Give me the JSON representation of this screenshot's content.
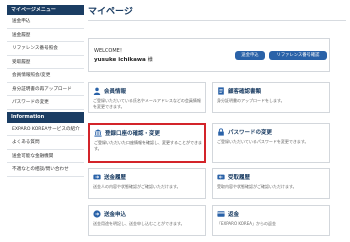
{
  "sidebar": {
    "header": "マイページメニュー",
    "items": [
      "送金申込",
      "送金履歴",
      "リファレンス番号照会",
      "受取履歴",
      "会員情報照会/変更",
      "身分証明書の再アップロード",
      "パスワードの変更"
    ],
    "info_header": "Information",
    "info_items": [
      "EXPARO KOREAサービスの紹介",
      "よくある質問",
      "送金可能な金融機関",
      "不適なとの相談/問い合わせ"
    ]
  },
  "main": {
    "title": "マイページ",
    "welcome": {
      "greeting": "WELCOME！",
      "user": "yusuke ichikawa",
      "honorific": "様",
      "badge1": "送金申込",
      "badge2": "リファレンス番号確認"
    },
    "cards": [
      {
        "title": "会員情報",
        "desc": "ご登録いただいている氏名やメールアドレスなどの会員情報を変更できます。"
      },
      {
        "title": "顧客確認書類",
        "desc": "身分証明書のアップロードをします。"
      },
      {
        "title": "登録口座の確認・変更",
        "desc": "ご登録いただいた口座情報を確認し、変更することができます。"
      },
      {
        "title": "パスワードの変更",
        "desc": "ご登録いただいているパスワードを変更できます。"
      },
      {
        "title": "送金履歴",
        "desc": "送金人の内容や状態確認がご確認いただけます。"
      },
      {
        "title": "受取履歴",
        "desc": "受取内容や状態確認がご確認いただけます。"
      },
      {
        "title": "送金申込",
        "desc": "送金用途を明記し、送金申し込むことができます。"
      },
      {
        "title": "返金",
        "desc": "「EXPARO KOREA」からの返金"
      }
    ]
  },
  "colors": {
    "navy": "#1b3d63",
    "accent_blue": "#2a62a8",
    "highlight_red": "#d3242a"
  },
  "icons": [
    "user-icon",
    "document-icon",
    "bank-icon",
    "lock-icon",
    "send-icon",
    "receive-icon",
    "remit-icon",
    "refund-icon"
  ]
}
